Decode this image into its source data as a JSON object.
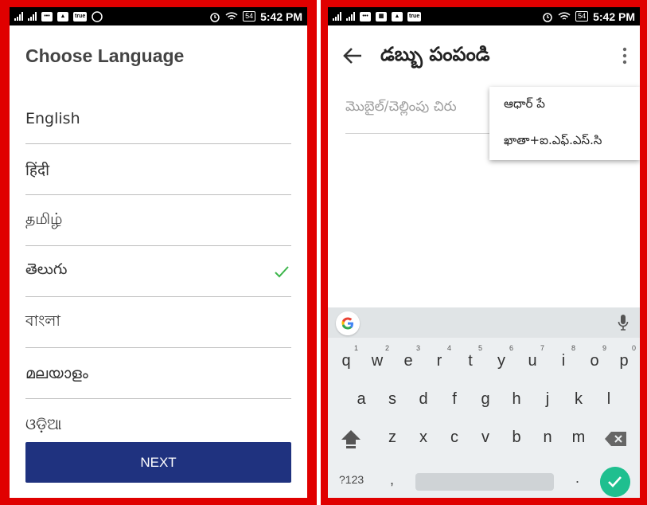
{
  "statusbar": {
    "time": "5:42 PM",
    "battery": "54",
    "badge_true": "true"
  },
  "left": {
    "title": "Choose Language",
    "languages": [
      {
        "label": "English",
        "selected": false
      },
      {
        "label": "हिंदी",
        "selected": false
      },
      {
        "label": "தமிழ்",
        "selected": false
      },
      {
        "label": "తెలుగు",
        "selected": true
      },
      {
        "label": "বাংলা",
        "selected": false
      },
      {
        "label": "മലയാളം",
        "selected": false
      },
      {
        "label": "ଓଡ଼ିଆ",
        "selected": false
      }
    ],
    "next_label": "NEXT",
    "accent_color": "#1f327f",
    "check_color": "#3bb54a"
  },
  "right": {
    "title": "డబ్బు పంపండి",
    "field_placeholder": "మొబైల్/చెల్లింపు చిరు",
    "menu": [
      {
        "label": "ఆధార్ పే"
      },
      {
        "label": "ఖాతా+ఐ.ఎఫ్.ఎస్.సి"
      }
    ],
    "keyboard": {
      "row1": [
        {
          "k": "q",
          "n": "1"
        },
        {
          "k": "w",
          "n": "2"
        },
        {
          "k": "e",
          "n": "3"
        },
        {
          "k": "r",
          "n": "4"
        },
        {
          "k": "t",
          "n": "5"
        },
        {
          "k": "y",
          "n": "6"
        },
        {
          "k": "u",
          "n": "7"
        },
        {
          "k": "i",
          "n": "8"
        },
        {
          "k": "o",
          "n": "9"
        },
        {
          "k": "p",
          "n": "0"
        }
      ],
      "row2": [
        "a",
        "s",
        "d",
        "f",
        "g",
        "h",
        "j",
        "k",
        "l"
      ],
      "row3": [
        "z",
        "x",
        "c",
        "v",
        "b",
        "n",
        "m"
      ],
      "sym_label": "?123",
      "comma": ",",
      "dot": "."
    }
  },
  "icons": {
    "check": "check-icon",
    "back": "arrow-left-icon",
    "overflow": "more-vert-icon",
    "google": "google-icon",
    "mic": "mic-icon",
    "shift": "shift-icon",
    "backspace": "backspace-icon",
    "enter": "enter-check-icon"
  }
}
